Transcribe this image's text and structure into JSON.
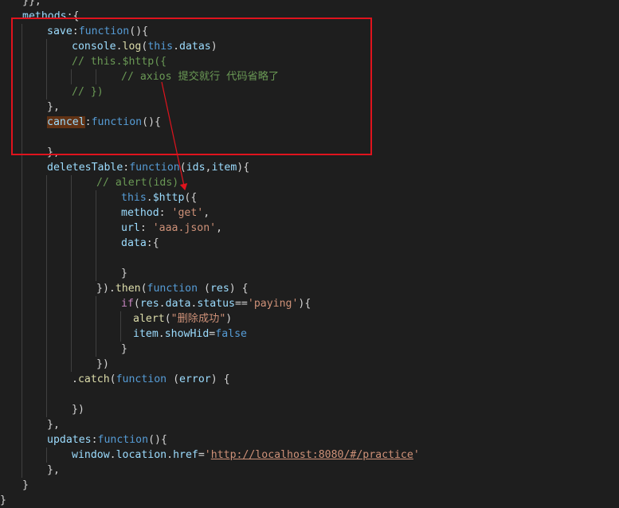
{
  "colors": {
    "background": "#1e1e1e",
    "keyword": "#569cd6",
    "property": "#9cdcfe",
    "string": "#ce9178",
    "comment": "#6a9955",
    "function": "#dcdcaa",
    "text": "#d4d4d4",
    "annotation": "#e0131d"
  },
  "code_lines": [
    {
      "indent": 28,
      "tokens": [
        {
          "text": "}},",
          "color": "#d4d4d4"
        }
      ]
    },
    {
      "indent": 28,
      "tokens": [
        {
          "text": "methods",
          "color": "#9cdcfe"
        },
        {
          "text": ":{",
          "color": "#d4d4d4"
        }
      ]
    },
    {
      "indent": 59,
      "tokens": [
        {
          "text": "save",
          "color": "#9cdcfe"
        },
        {
          "text": ":",
          "color": "#d4d4d4"
        },
        {
          "text": "function",
          "color": "#569cd6"
        },
        {
          "text": "(){",
          "color": "#d4d4d4"
        }
      ]
    },
    {
      "indent": 90,
      "tokens": [
        {
          "text": "console",
          "color": "#9cdcfe"
        },
        {
          "text": ".",
          "color": "#d4d4d4"
        },
        {
          "text": "log",
          "color": "#dcdcaa"
        },
        {
          "text": "(",
          "color": "#d4d4d4"
        },
        {
          "text": "this",
          "color": "#569cd6"
        },
        {
          "text": ".",
          "color": "#d4d4d4"
        },
        {
          "text": "datas",
          "color": "#9cdcfe"
        },
        {
          "text": ")",
          "color": "#d4d4d4"
        }
      ]
    },
    {
      "indent": 90,
      "tokens": [
        {
          "text": "// this.$http({",
          "color": "#6a9955"
        }
      ]
    },
    {
      "indent": 152,
      "tokens": [
        {
          "text": "// axios 提交就行 代码省略了",
          "color": "#6a9955"
        }
      ]
    },
    {
      "indent": 90,
      "tokens": [
        {
          "text": "// })",
          "color": "#6a9955"
        }
      ]
    },
    {
      "indent": 59,
      "tokens": [
        {
          "text": "},",
          "color": "#d4d4d4"
        }
      ]
    },
    {
      "indent": 59,
      "tokens": [
        {
          "text": "cancel",
          "color": "#9cdcfe",
          "highlight": true
        },
        {
          "text": ":",
          "color": "#d4d4d4"
        },
        {
          "text": "function",
          "color": "#569cd6"
        },
        {
          "text": "(){",
          "color": "#d4d4d4"
        }
      ]
    },
    {
      "indent": 59,
      "tokens": []
    },
    {
      "indent": 59,
      "tokens": [
        {
          "text": "},",
          "color": "#d4d4d4"
        }
      ]
    },
    {
      "indent": 59,
      "tokens": [
        {
          "text": "deletesTable",
          "color": "#9cdcfe"
        },
        {
          "text": ":",
          "color": "#d4d4d4"
        },
        {
          "text": "function",
          "color": "#569cd6"
        },
        {
          "text": "(",
          "color": "#d4d4d4"
        },
        {
          "text": "ids",
          "color": "#9cdcfe"
        },
        {
          "text": ",",
          "color": "#d4d4d4"
        },
        {
          "text": "item",
          "color": "#9cdcfe"
        },
        {
          "text": "){",
          "color": "#d4d4d4"
        }
      ]
    },
    {
      "indent": 121,
      "tokens": [
        {
          "text": "// alert(ids)",
          "color": "#6a9955"
        }
      ]
    },
    {
      "indent": 152,
      "tokens": [
        {
          "text": "this",
          "color": "#569cd6"
        },
        {
          "text": ".",
          "color": "#d4d4d4"
        },
        {
          "text": "$http",
          "color": "#9cdcfe"
        },
        {
          "text": "({",
          "color": "#d4d4d4"
        }
      ]
    },
    {
      "indent": 152,
      "tokens": [
        {
          "text": "method",
          "color": "#9cdcfe"
        },
        {
          "text": ": ",
          "color": "#d4d4d4"
        },
        {
          "text": "'get'",
          "color": "#ce9178"
        },
        {
          "text": ",",
          "color": "#d4d4d4"
        }
      ]
    },
    {
      "indent": 152,
      "tokens": [
        {
          "text": "url",
          "color": "#9cdcfe"
        },
        {
          "text": ": ",
          "color": "#d4d4d4"
        },
        {
          "text": "'aaa.json'",
          "color": "#ce9178"
        },
        {
          "text": ",",
          "color": "#d4d4d4"
        }
      ]
    },
    {
      "indent": 152,
      "tokens": [
        {
          "text": "data",
          "color": "#9cdcfe"
        },
        {
          "text": ":{",
          "color": "#d4d4d4"
        }
      ]
    },
    {
      "indent": 152,
      "tokens": []
    },
    {
      "indent": 152,
      "tokens": [
        {
          "text": "}",
          "color": "#d4d4d4"
        }
      ]
    },
    {
      "indent": 121,
      "tokens": [
        {
          "text": "}).",
          "color": "#d4d4d4"
        },
        {
          "text": "then",
          "color": "#dcdcaa"
        },
        {
          "text": "(",
          "color": "#d4d4d4"
        },
        {
          "text": "function",
          "color": "#569cd6"
        },
        {
          "text": " (",
          "color": "#d4d4d4"
        },
        {
          "text": "res",
          "color": "#9cdcfe"
        },
        {
          "text": ") {",
          "color": "#d4d4d4"
        }
      ]
    },
    {
      "indent": 152,
      "tokens": [
        {
          "text": "if",
          "color": "#c586c0"
        },
        {
          "text": "(",
          "color": "#d4d4d4"
        },
        {
          "text": "res",
          "color": "#9cdcfe"
        },
        {
          "text": ".",
          "color": "#d4d4d4"
        },
        {
          "text": "data",
          "color": "#9cdcfe"
        },
        {
          "text": ".",
          "color": "#d4d4d4"
        },
        {
          "text": "status",
          "color": "#9cdcfe"
        },
        {
          "text": "==",
          "color": "#d4d4d4"
        },
        {
          "text": "'paying'",
          "color": "#ce9178"
        },
        {
          "text": "){",
          "color": "#d4d4d4"
        }
      ]
    },
    {
      "indent": 167,
      "tokens": [
        {
          "text": "alert",
          "color": "#dcdcaa"
        },
        {
          "text": "(",
          "color": "#d4d4d4"
        },
        {
          "text": "\"删除成功\"",
          "color": "#ce9178"
        },
        {
          "text": ")",
          "color": "#d4d4d4"
        }
      ]
    },
    {
      "indent": 167,
      "tokens": [
        {
          "text": "item",
          "color": "#9cdcfe"
        },
        {
          "text": ".",
          "color": "#d4d4d4"
        },
        {
          "text": "showHid",
          "color": "#9cdcfe"
        },
        {
          "text": "=",
          "color": "#d4d4d4"
        },
        {
          "text": "false",
          "color": "#569cd6"
        }
      ]
    },
    {
      "indent": 152,
      "tokens": [
        {
          "text": "}",
          "color": "#d4d4d4"
        }
      ]
    },
    {
      "indent": 121,
      "tokens": [
        {
          "text": "})",
          "color": "#d4d4d4"
        }
      ]
    },
    {
      "indent": 90,
      "tokens": [
        {
          "text": ".",
          "color": "#d4d4d4"
        },
        {
          "text": "catch",
          "color": "#dcdcaa"
        },
        {
          "text": "(",
          "color": "#d4d4d4"
        },
        {
          "text": "function",
          "color": "#569cd6"
        },
        {
          "text": " (",
          "color": "#d4d4d4"
        },
        {
          "text": "error",
          "color": "#9cdcfe"
        },
        {
          "text": ") {",
          "color": "#d4d4d4"
        }
      ]
    },
    {
      "indent": 90,
      "tokens": []
    },
    {
      "indent": 90,
      "tokens": [
        {
          "text": "})",
          "color": "#d4d4d4"
        }
      ]
    },
    {
      "indent": 59,
      "tokens": [
        {
          "text": "},",
          "color": "#d4d4d4"
        }
      ]
    },
    {
      "indent": 59,
      "tokens": [
        {
          "text": "updates",
          "color": "#9cdcfe"
        },
        {
          "text": ":",
          "color": "#d4d4d4"
        },
        {
          "text": "function",
          "color": "#569cd6"
        },
        {
          "text": "(){",
          "color": "#d4d4d4"
        }
      ]
    },
    {
      "indent": 90,
      "tokens": [
        {
          "text": "window",
          "color": "#9cdcfe"
        },
        {
          "text": ".",
          "color": "#d4d4d4"
        },
        {
          "text": "location",
          "color": "#9cdcfe"
        },
        {
          "text": ".",
          "color": "#d4d4d4"
        },
        {
          "text": "href",
          "color": "#9cdcfe"
        },
        {
          "text": "=",
          "color": "#d4d4d4"
        },
        {
          "text": "'",
          "color": "#ce9178"
        },
        {
          "text": "http://localhost:8080/#/practice",
          "color": "#ce9178",
          "link": true
        },
        {
          "text": "'",
          "color": "#ce9178"
        }
      ]
    },
    {
      "indent": 59,
      "tokens": [
        {
          "text": "},",
          "color": "#d4d4d4"
        }
      ]
    },
    {
      "indent": 28,
      "tokens": [
        {
          "text": "}",
          "color": "#d4d4d4"
        }
      ]
    },
    {
      "indent": 0,
      "tokens": [
        {
          "text": "}",
          "color": "#d4d4d4"
        }
      ]
    }
  ]
}
